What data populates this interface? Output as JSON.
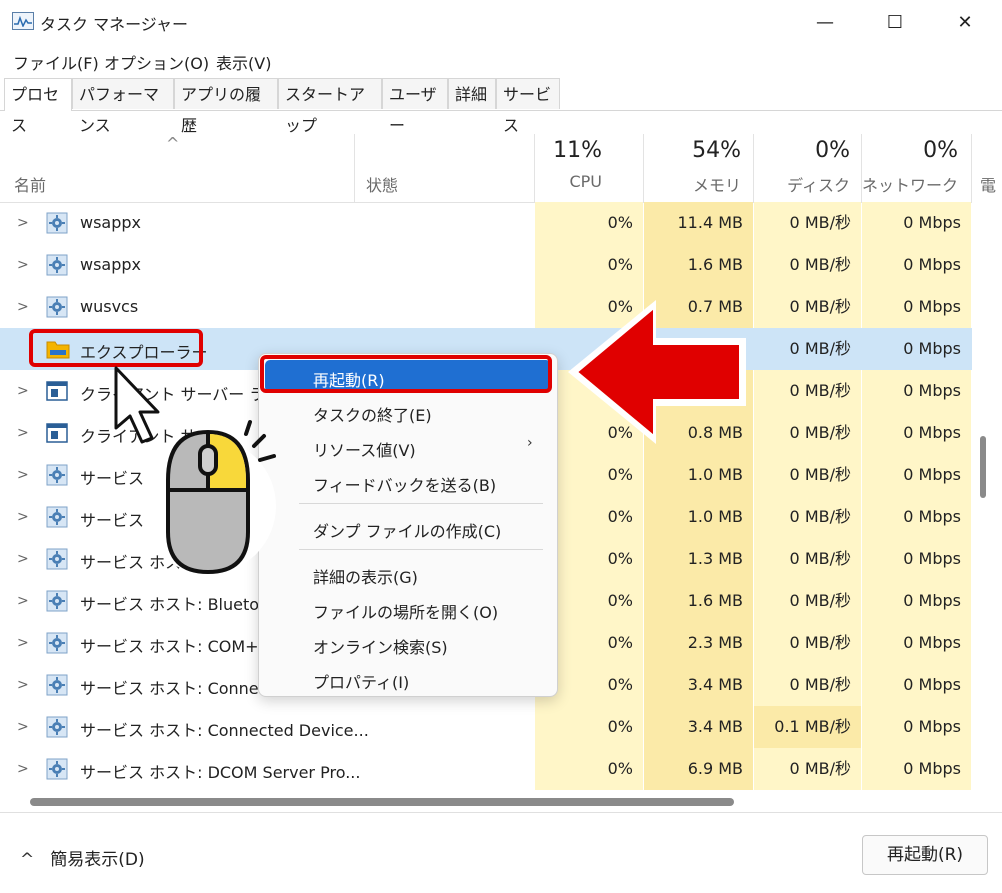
{
  "window": {
    "title": "タスク マネージャー",
    "minimize_glyph": "—",
    "maximize_glyph": "☐",
    "close_glyph": "✕"
  },
  "menu": [
    "ファイル(F)",
    "オプション(O)",
    "表示(V)"
  ],
  "tabs": [
    "プロセス",
    "パフォーマンス",
    "アプリの履歴",
    "スタートアップ",
    "ユーザー",
    "詳細",
    "サービス"
  ],
  "columns": {
    "sort_arrow": "^",
    "name": "名前",
    "status": "状態",
    "cpu_pct": "11%",
    "cpu": "CPU",
    "mem_pct": "54%",
    "mem": "メモリ",
    "disk_pct": "0%",
    "disk": "ディスク",
    "net_pct": "0%",
    "net": "ネットワーク",
    "power": "電"
  },
  "rows": [
    {
      "name": "wsappx",
      "cpu": "0%",
      "mem": "11.4 MB",
      "disk": "0 MB/秒",
      "net": "0 Mbps",
      "icon": "gear-icon"
    },
    {
      "name": "wsappx",
      "cpu": "0%",
      "mem": "1.6 MB",
      "disk": "0 MB/秒",
      "net": "0 Mbps",
      "icon": "gear-icon"
    },
    {
      "name": "wusvcs",
      "cpu": "0%",
      "mem": "0.7 MB",
      "disk": "0 MB/秒",
      "net": "0 Mbps",
      "icon": "gear-icon"
    },
    {
      "name": "エクスプローラー",
      "cpu": "",
      "mem": "8",
      "disk": "0 MB/秒",
      "net": "0 Mbps",
      "icon": "folder-icon"
    },
    {
      "name": "クライアント サーバー ランタ",
      "cpu": "",
      "mem": "8",
      "disk": "0 MB/秒",
      "net": "0 Mbps",
      "icon": "window-icon"
    },
    {
      "name": "クライアント サ",
      "cpu": "0%",
      "mem": "0.8 MB",
      "disk": "0 MB/秒",
      "net": "0 Mbps",
      "icon": "window-icon"
    },
    {
      "name": "サービス ホ",
      "cpu": "0%",
      "mem": "1.0 MB",
      "disk": "0 MB/秒",
      "net": "0 Mbps",
      "icon": "gear-icon"
    },
    {
      "name": "サービス ホ",
      "cpu": "0%",
      "mem": "1.0 MB",
      "disk": "0 MB/秒",
      "net": "0 Mbps",
      "icon": "gear-icon"
    },
    {
      "name": "サービス ホス",
      "cpu": "0%",
      "mem": "1.3 MB",
      "disk": "0 MB/秒",
      "net": "0 Mbps",
      "icon": "gear-icon"
    },
    {
      "name": "サービス ホスト: Bluetoot",
      "cpu": "0%",
      "mem": "1.6 MB",
      "disk": "0 MB/秒",
      "net": "0 Mbps",
      "icon": "gear-icon"
    },
    {
      "name": "サービス ホスト: COM+ E",
      "cpu": "0%",
      "mem": "2.3 MB",
      "disk": "0 MB/秒",
      "net": "0 Mbps",
      "icon": "gear-icon"
    },
    {
      "name": "サービス ホスト: Connecte",
      "cpu": "0%",
      "mem": "3.4 MB",
      "disk": "0 MB/秒",
      "net": "0 Mbps",
      "icon": "gear-icon"
    },
    {
      "name": "サービス ホスト: Connected Device...",
      "cpu": "0%",
      "mem": "3.4 MB",
      "disk": "0.1 MB/秒",
      "net": "0 Mbps",
      "icon": "gear-icon"
    },
    {
      "name": "サービス ホスト: DCOM Server Pro...",
      "cpu": "0%",
      "mem": "6.9 MB",
      "disk": "0 MB/秒",
      "net": "0 Mbps",
      "icon": "gear-icon"
    }
  ],
  "context_menu": {
    "restart": "再起動(R)",
    "end_task": "タスクの終了(E)",
    "resource_values": "リソース値(V)",
    "submenu_arrow": "›",
    "feedback": "フィードバックを送る(B)",
    "dump": "ダンプ ファイルの作成(C)",
    "details": "詳細の表示(G)",
    "open_location": "ファイルの場所を開く(O)",
    "search_online": "オンライン検索(S)",
    "properties": "プロパティ(I)"
  },
  "footer": {
    "compact_glyph": "^",
    "compact": "簡易表示(D)",
    "restart_button": "再起動(R)"
  },
  "colors": {
    "accent": "#1f6fd2",
    "annotation_red": "#e00000",
    "heat_light": "#fff6c8",
    "heat_medium": "#fbeaa8",
    "selection": "#cde4f7"
  }
}
